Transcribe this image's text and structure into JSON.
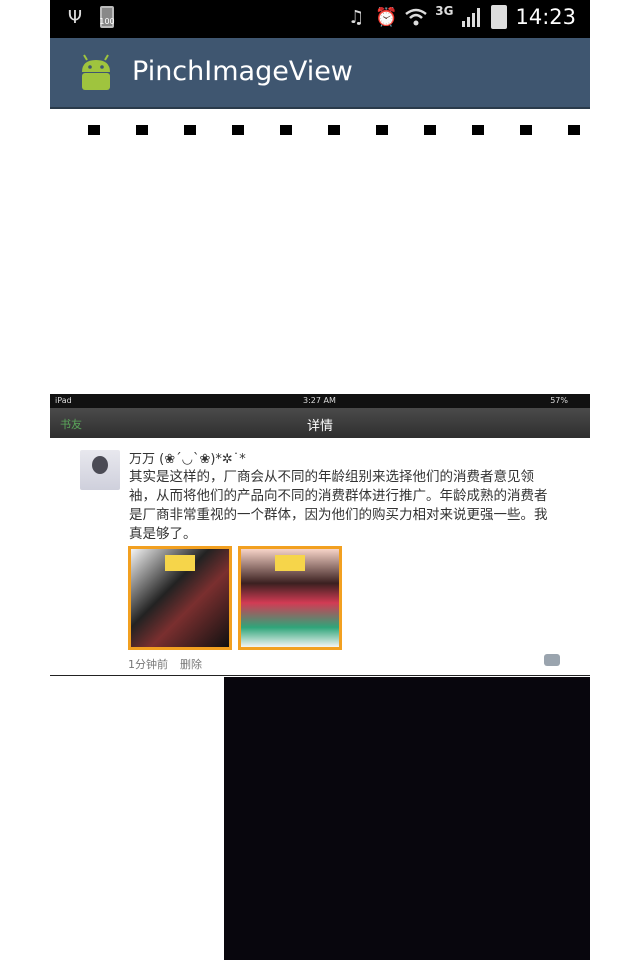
{
  "status_bar": {
    "time": "14:23",
    "battery_small_label": "100",
    "network": "3G",
    "icons": [
      "usb-icon",
      "battery-icon",
      "mute-icon",
      "alarm-icon",
      "wifi-icon",
      "signal-icon",
      "battery-icon"
    ]
  },
  "action_bar": {
    "title": "PinchImageView",
    "logo": "android-icon",
    "color": "#3f5670"
  },
  "ipad": {
    "status_left": "iPad",
    "status_time": "3:27 AM",
    "status_battery": "57%",
    "back_label": "书友",
    "title": "详情",
    "post": {
      "user": "万万 (❀´◡`❀)*✲˙*",
      "text": "其实是这样的，厂商会从不同的年龄组别来选择他们的消费者意见领袖，从而将他们的产品向不同的消费群体进行推广。年龄成熟的消费者是厂商非常重视的一个群体，因为他们的购买力相对来说更强一些。我真是够了。",
      "time": "1分钟前",
      "delete_label": "删除"
    }
  }
}
